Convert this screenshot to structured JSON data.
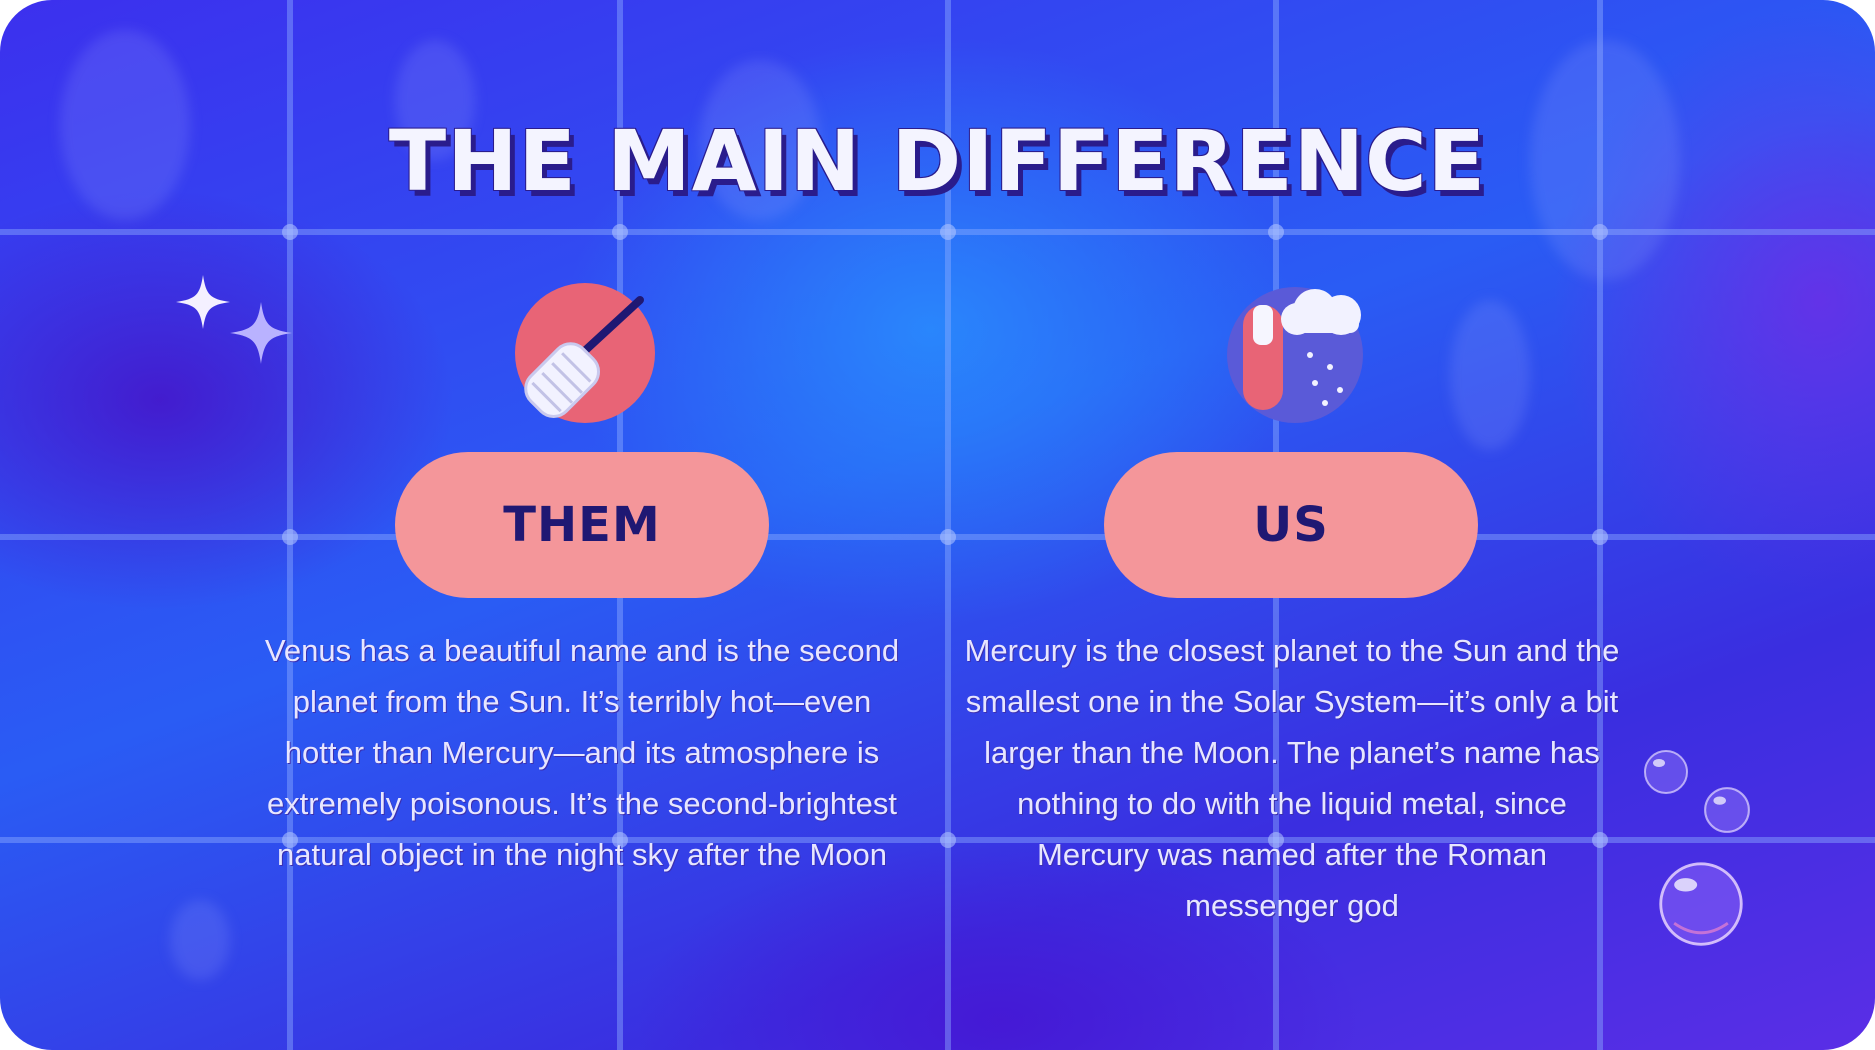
{
  "slide": {
    "title": "THE MAIN DIFFERENCE"
  },
  "columns": [
    {
      "label": "THEM",
      "icon": "broom-icon",
      "text": "Venus has a beautiful name and is the second planet from the Sun. It’s terribly hot—even hotter than Mercury—and its atmosphere is extremely poisonous. It’s the second-brightest natural object in the night sky after the Moon"
    },
    {
      "label": "US",
      "icon": "weather-thermometer-icon",
      "text": "Mercury is the closest planet to the Sun and the smallest one in the Solar System—it’s only a bit larger than the Moon. The planet’s name has nothing to do with the liquid metal, since Mercury was named after the Roman messenger god"
    }
  ],
  "colors": {
    "background": "#3a3ff0",
    "pill": "#f4969a",
    "pill_text": "#1f1873",
    "title_text": "#f4f4ff",
    "body_text": "#e7e6ff"
  },
  "decorations": [
    "sparkle-icon",
    "bubble"
  ]
}
